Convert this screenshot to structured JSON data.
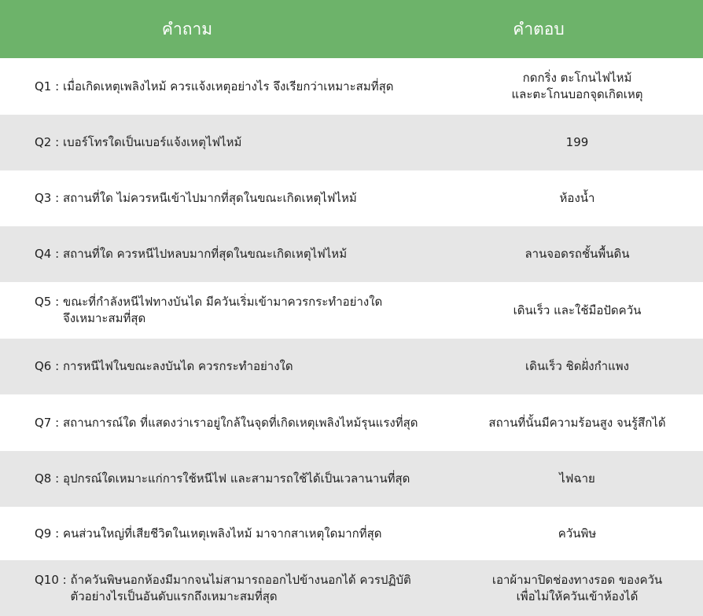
{
  "header": {
    "question_label": "คำถาม",
    "answer_label": "คำตอบ"
  },
  "colors": {
    "header_bg": "#6db36a",
    "header_text": "#ffffff",
    "row_alt_bg": "#e6e6e6",
    "row_bg": "#ffffff"
  },
  "rows": [
    {
      "num": "Q1",
      "question": "เมื่อเกิดเหตุเพลิงไหม้ ควรแจ้งเหตุอย่างไร จึงเรียกว่าเหมาะสมที่สุด",
      "answer": "กดกริ่ง ตะโกนไฟไหม้\nและตะโกนบอกจุดเกิดเหตุ"
    },
    {
      "num": "Q2",
      "question": "เบอร์โทรใดเป็นเบอร์แจ้งเหตุไฟไหม้",
      "answer": "199"
    },
    {
      "num": "Q3",
      "question": "สถานที่ใด ไม่ควรหนีเข้าไปมากที่สุดในขณะเกิดเหตุไฟไหม้",
      "answer": "ห้องน้ำ"
    },
    {
      "num": "Q4",
      "question": "สถานที่ใด ควรหนีไปหลบมากที่สุดในขณะเกิดเหตุไฟไหม้",
      "answer": "ลานจอดรถชั้นพื้นดิน"
    },
    {
      "num": "Q5",
      "question": "ขณะที่กำลังหนีไฟทางบันได มีควันเริ่มเข้ามาควรกระทำอย่างใด\nจึงเหมาะสมที่สุด",
      "answer": "เดินเร็ว และใช้มือปัดควัน"
    },
    {
      "num": "Q6",
      "question": "การหนีไฟในขณะลงบันได ควรกระทำอย่างใด",
      "answer": "เดินเร็ว ชิดฝั่งกำแพง"
    },
    {
      "num": "Q7",
      "question": "สถานการณ์ใด ที่แสดงว่าเราอยู่ใกล้ในจุดที่เกิดเหตุเพลิงไหม้รุนแรงที่สุด",
      "answer": "สถานที่นั้นมีความร้อนสูง จนรู้สึกได้"
    },
    {
      "num": "Q8",
      "question": "อุปกรณ์ใดเหมาะแก่การใช้หนีไฟ และสามารถใช้ได้เป็นเวลานานที่สุด",
      "answer": "ไฟฉาย"
    },
    {
      "num": "Q9",
      "question": "คนส่วนใหญ่ที่เสียชีวิตในเหตุเพลิงไหม้ มาจากสาเหตุใดมากที่สุด",
      "answer": "ควันพิษ"
    },
    {
      "num": "Q10",
      "question": "ถ้าควันพิษนอกห้องมีมากจนไม่สามารถออกไปข้างนอกได้ ควรปฏิบัติ\nตัวอย่างไรเป็นอันดับแรกถึงเหมาะสมที่สุด",
      "answer": "เอาผ้ามาปิดช่องทางรอด ของควัน\nเพื่อไม่ให้ควันเข้าห้องได้"
    }
  ]
}
